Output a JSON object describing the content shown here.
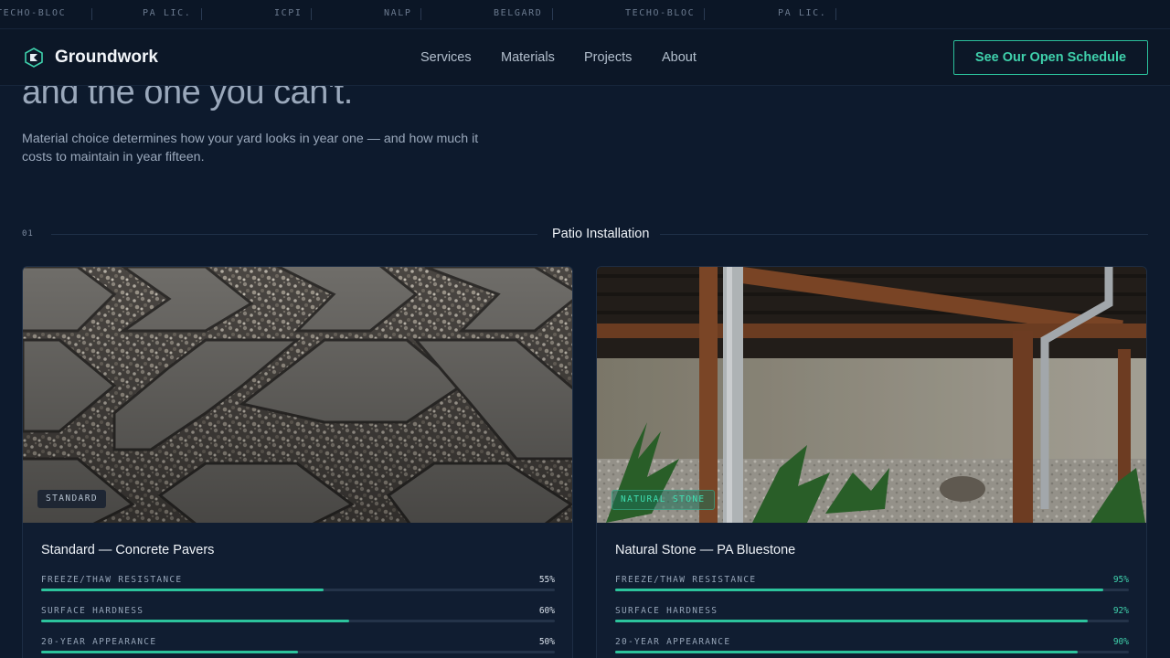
{
  "ticker": [
    "TECHO-BLOC",
    "PA LIC.",
    "ICPI",
    "NALP",
    "BELGARD",
    "TECHO-BLOC",
    "PA LIC."
  ],
  "header": {
    "brand": "Groundwork",
    "logo_icon": "leaf-block-icon",
    "nav": [
      "Services",
      "Materials",
      "Projects",
      "About"
    ],
    "cta": "See Our Open Schedule"
  },
  "hero": {
    "title": "and the one you can't.",
    "subtitle": "Material choice determines how your yard looks in year one — and how much it costs to maintain in year fifteen."
  },
  "section": {
    "number": "01",
    "title": "Patio Installation"
  },
  "cards": [
    {
      "badge": "STANDARD",
      "title": "Standard — Concrete Pavers",
      "image": "concrete-pavers-photo",
      "metrics": [
        {
          "label": "FREEZE/THAW RESISTANCE",
          "value": "55%",
          "fraction": 0.55
        },
        {
          "label": "SURFACE HARDNESS",
          "value": "60%",
          "fraction": 0.6
        },
        {
          "label": "20-YEAR APPEARANCE",
          "value": "50%",
          "fraction": 0.5
        }
      ]
    },
    {
      "badge": "NATURAL STONE",
      "title": "Natural Stone — PA Bluestone",
      "image": "covered-patio-photo",
      "metrics": [
        {
          "label": "FREEZE/THAW RESISTANCE",
          "value": "95%",
          "fraction": 0.95
        },
        {
          "label": "SURFACE HARDNESS",
          "value": "92%",
          "fraction": 0.92
        },
        {
          "label": "20-YEAR APPEARANCE",
          "value": "90%",
          "fraction": 0.9
        }
      ]
    }
  ],
  "colors": {
    "background": "#0d1a2d",
    "accent": "#2cc39c",
    "accent_text": "#3fd1ac"
  }
}
